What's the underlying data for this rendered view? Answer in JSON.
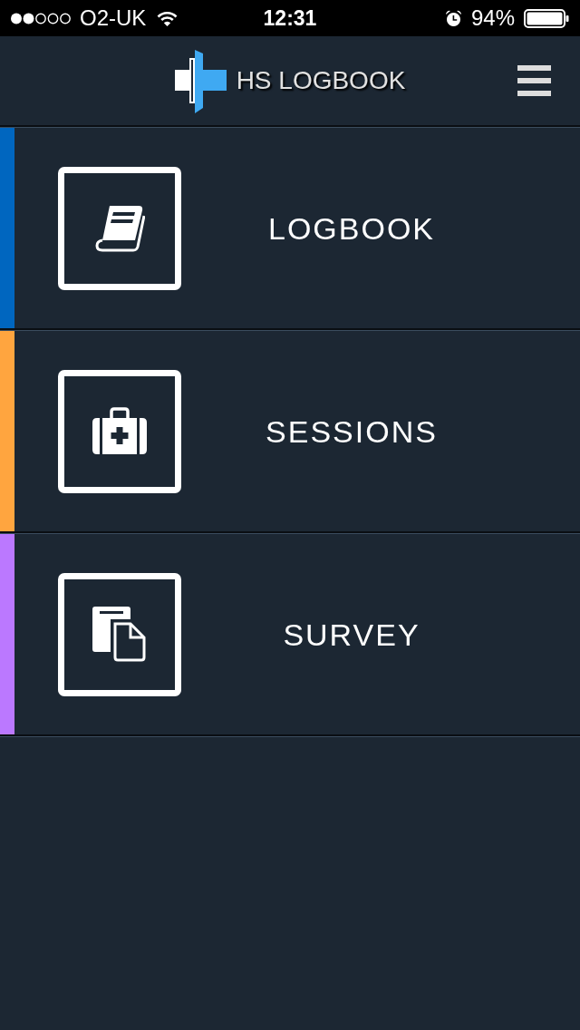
{
  "status_bar": {
    "carrier": "O2-UK",
    "time": "12:31",
    "battery": "94%"
  },
  "header": {
    "title": "HS LOGBOOK"
  },
  "menu": [
    {
      "label": "LOGBOOK",
      "kind": "book",
      "color": "#0066bf"
    },
    {
      "label": "SESSIONS",
      "kind": "medkit",
      "color": "#ffa53f"
    },
    {
      "label": "SURVEY",
      "kind": "documents",
      "color": "#bb78ff"
    }
  ]
}
